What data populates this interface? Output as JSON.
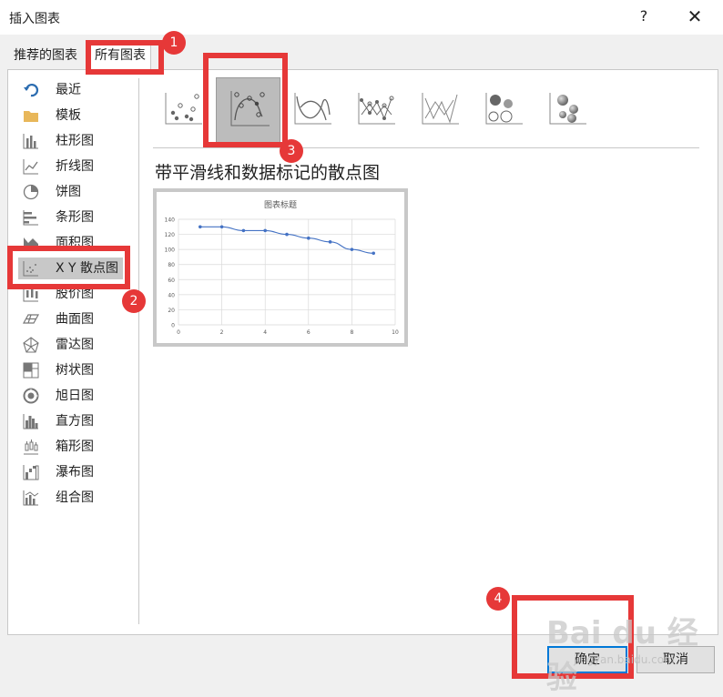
{
  "dialog": {
    "title": "插入图表",
    "help_label": "?",
    "close_label": "✕"
  },
  "tabs": [
    {
      "label": "推荐的图表",
      "active": false
    },
    {
      "label": "所有图表",
      "active": true
    }
  ],
  "categories": [
    {
      "label": "最近",
      "icon": "recent-icon"
    },
    {
      "label": "模板",
      "icon": "folder-icon"
    },
    {
      "label": "柱形图",
      "icon": "column-chart-icon"
    },
    {
      "label": "折线图",
      "icon": "line-chart-icon"
    },
    {
      "label": "饼图",
      "icon": "pie-chart-icon"
    },
    {
      "label": "条形图",
      "icon": "bar-chart-icon"
    },
    {
      "label": "面积图",
      "icon": "area-chart-icon"
    },
    {
      "label": "X Y 散点图",
      "icon": "scatter-chart-icon",
      "selected": true
    },
    {
      "label": "股价图",
      "icon": "stock-chart-icon"
    },
    {
      "label": "曲面图",
      "icon": "surface-chart-icon"
    },
    {
      "label": "雷达图",
      "icon": "radar-chart-icon"
    },
    {
      "label": "树状图",
      "icon": "treemap-chart-icon"
    },
    {
      "label": "旭日图",
      "icon": "sunburst-chart-icon"
    },
    {
      "label": "直方图",
      "icon": "histogram-chart-icon"
    },
    {
      "label": "箱形图",
      "icon": "boxplot-chart-icon"
    },
    {
      "label": "瀑布图",
      "icon": "waterfall-chart-icon"
    },
    {
      "label": "组合图",
      "icon": "combo-chart-icon"
    }
  ],
  "subtypes": [
    {
      "icon": "scatter-icon"
    },
    {
      "icon": "scatter-smooth-markers-icon",
      "selected": true
    },
    {
      "icon": "scatter-smooth-lines-icon"
    },
    {
      "icon": "scatter-straight-markers-icon"
    },
    {
      "icon": "scatter-straight-lines-icon"
    },
    {
      "icon": "bubble-icon"
    },
    {
      "icon": "bubble-3d-icon"
    }
  ],
  "selected_chart_name": "带平滑线和数据标记的散点图",
  "preview": {
    "title": "图表标题"
  },
  "chart_data": {
    "type": "line",
    "title": "图表标题",
    "xlabel": "",
    "ylabel": "",
    "x_ticks": [
      "0",
      "2",
      "4",
      "6",
      "8",
      "10"
    ],
    "y_ticks": [
      "0",
      "20",
      "40",
      "60",
      "80",
      "100",
      "120",
      "140"
    ],
    "xlim": [
      0,
      10
    ],
    "ylim": [
      0,
      140
    ],
    "grid": true,
    "series": [
      {
        "x": [
          1,
          2,
          3,
          4,
          5,
          6,
          7,
          8,
          9
        ],
        "y": [
          130,
          130,
          125,
          125,
          120,
          115,
          110,
          100,
          95
        ]
      }
    ]
  },
  "buttons": {
    "ok": "确定",
    "cancel": "取消"
  },
  "annotations": [
    "1",
    "2",
    "3",
    "4"
  ],
  "colors": {
    "annotation": "#e63838",
    "series": "#4472c4",
    "selected_bg": "#c8c8c8"
  },
  "watermark": {
    "main": "Bai du 经验",
    "url": "jingyan.baidu.com"
  }
}
